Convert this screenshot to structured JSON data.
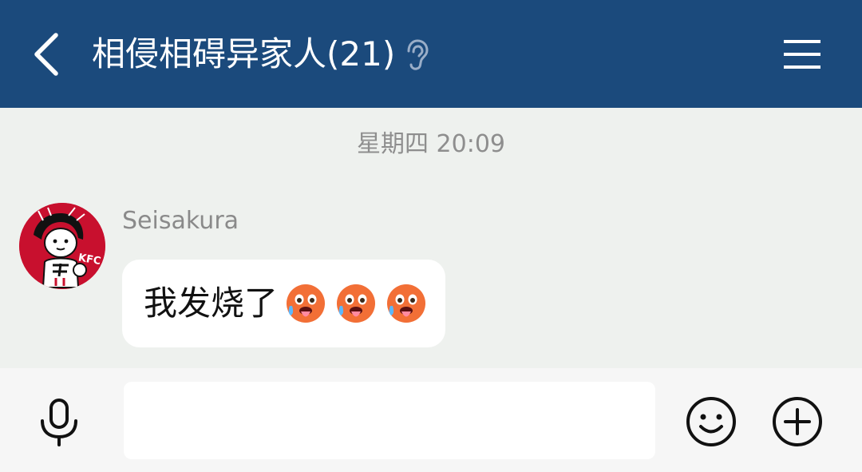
{
  "header": {
    "title": "相侵相碍异家人(21)",
    "background_color": "#1b4a7c",
    "back_icon": "chevron-left-icon",
    "mode_icon": "ear-icon",
    "menu_icon": "hamburger-menu-icon"
  },
  "chat": {
    "timestamp": "星期四 20:09",
    "messages": [
      {
        "sender": "Seisakura",
        "avatar_icon": "kfc-avatar",
        "avatar_badge": "KFC",
        "text": "我发烧了",
        "emojis": [
          "hot-face-emoji",
          "hot-face-emoji",
          "hot-face-emoji"
        ]
      }
    ]
  },
  "input_bar": {
    "value": "",
    "placeholder": "",
    "mic_icon": "microphone-icon",
    "emoji_icon": "smiley-icon",
    "plus_icon": "plus-circle-icon"
  }
}
